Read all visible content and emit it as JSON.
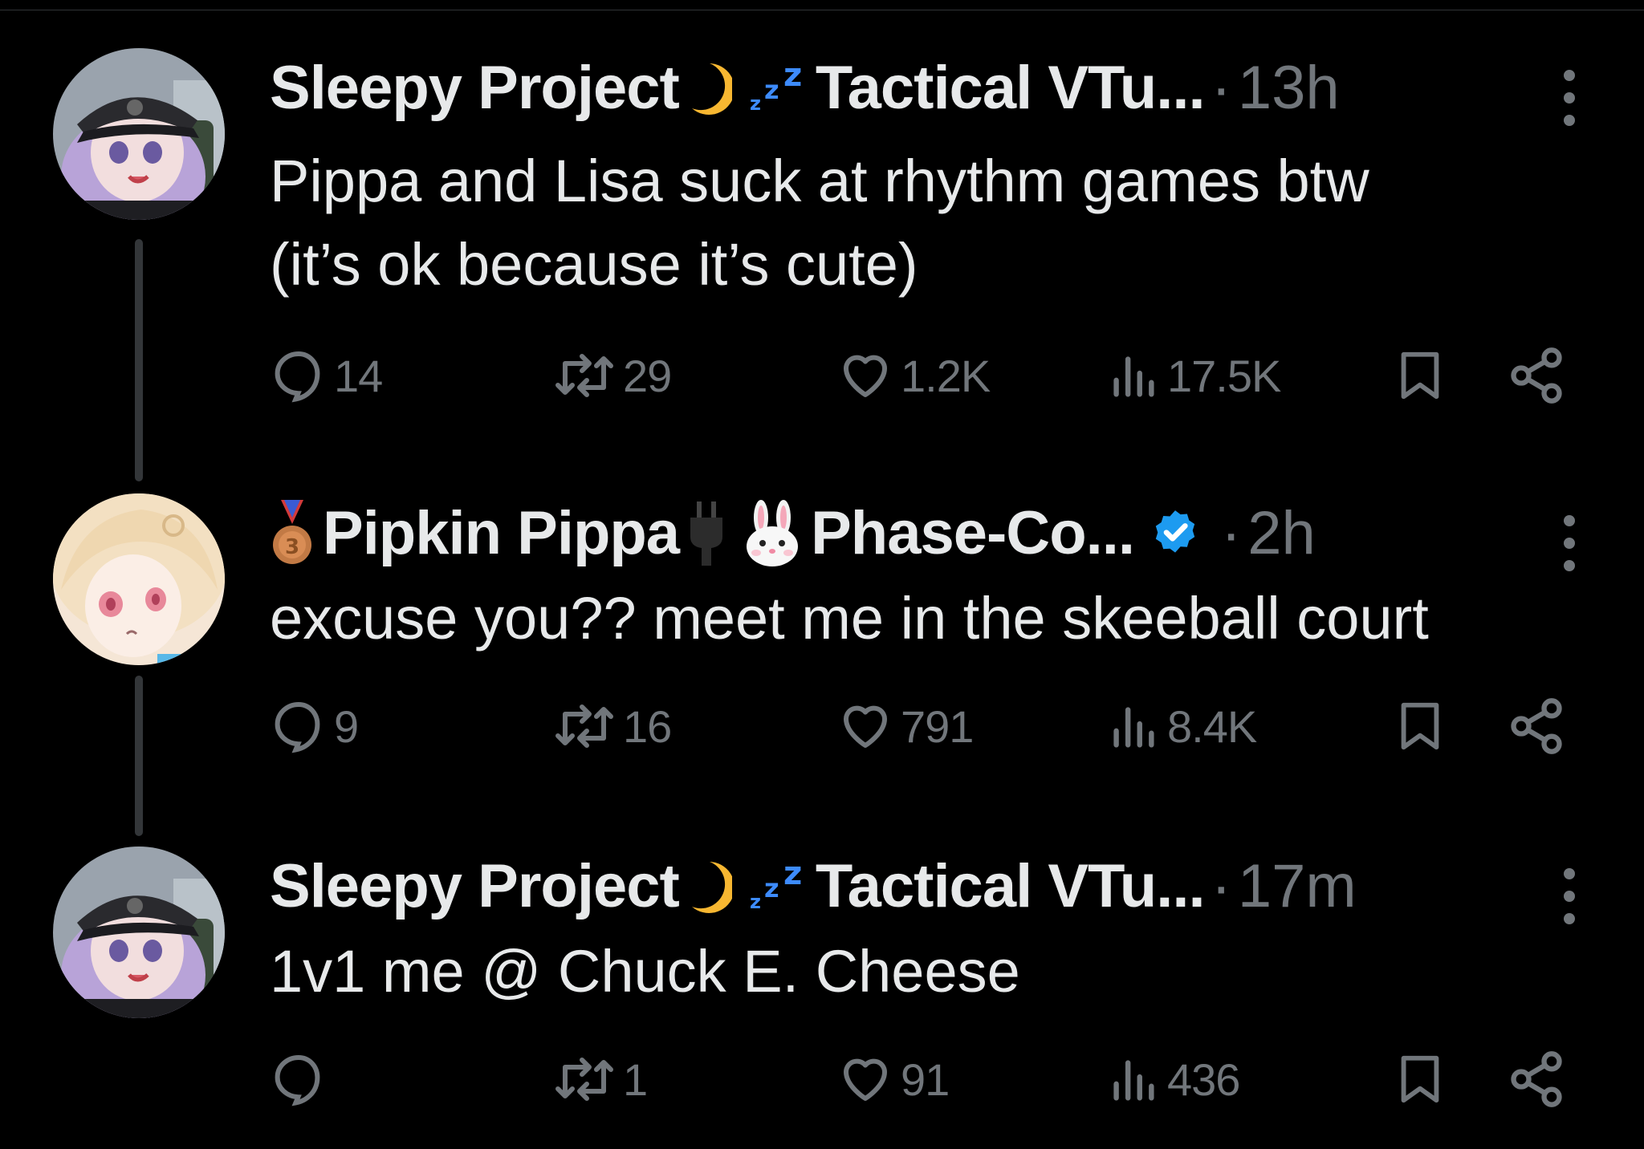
{
  "colors": {
    "background": "#000000",
    "text_primary": "#e7e9ea",
    "text_secondary": "#71767b",
    "thread_line": "#333639",
    "verified_blue": "#1d9bf0"
  },
  "tweets": [
    {
      "avatar_icon": "vtuber-avatar-cap-purple-hair",
      "name_part1": "Sleepy Project",
      "name_emoji1": "crescent-moon-icon",
      "name_emoji2": "zzz-icon",
      "name_part2": "Tactical VTu...",
      "separator": "·",
      "time": "13h",
      "text_lines": [
        "Pippa and Lisa suck at rhythm games btw",
        "(it’s ok because it’s cute)"
      ],
      "reply_count": "14",
      "repost_count": "29",
      "like_count": "1.2K",
      "view_count": "17.5K"
    },
    {
      "avatar_icon": "vtuber-avatar-blonde-pink-eyes",
      "name_emoji0": "bronze-medal-icon",
      "name_part1": "Pipkin Pippa",
      "name_emoji1": "plug-icon",
      "name_emoji2": "rabbit-face-icon",
      "name_part2": "Phase-Co...",
      "verified_icon": "verified-badge-icon",
      "separator": "·",
      "time": "2h",
      "text_lines": [
        "excuse you?? meet me in the skeeball court"
      ],
      "reply_count": "9",
      "repost_count": "16",
      "like_count": "791",
      "view_count": "8.4K"
    },
    {
      "avatar_icon": "vtuber-avatar-cap-purple-hair",
      "name_part1": "Sleepy Project",
      "name_emoji1": "crescent-moon-icon",
      "name_emoji2": "zzz-icon",
      "name_part2": "Tactical VTu...",
      "separator": "·",
      "time": "17m",
      "text_lines": [
        "1v1 me @ Chuck E. Cheese"
      ],
      "reply_count": "",
      "repost_count": "1",
      "like_count": "91",
      "view_count": "436"
    }
  ]
}
